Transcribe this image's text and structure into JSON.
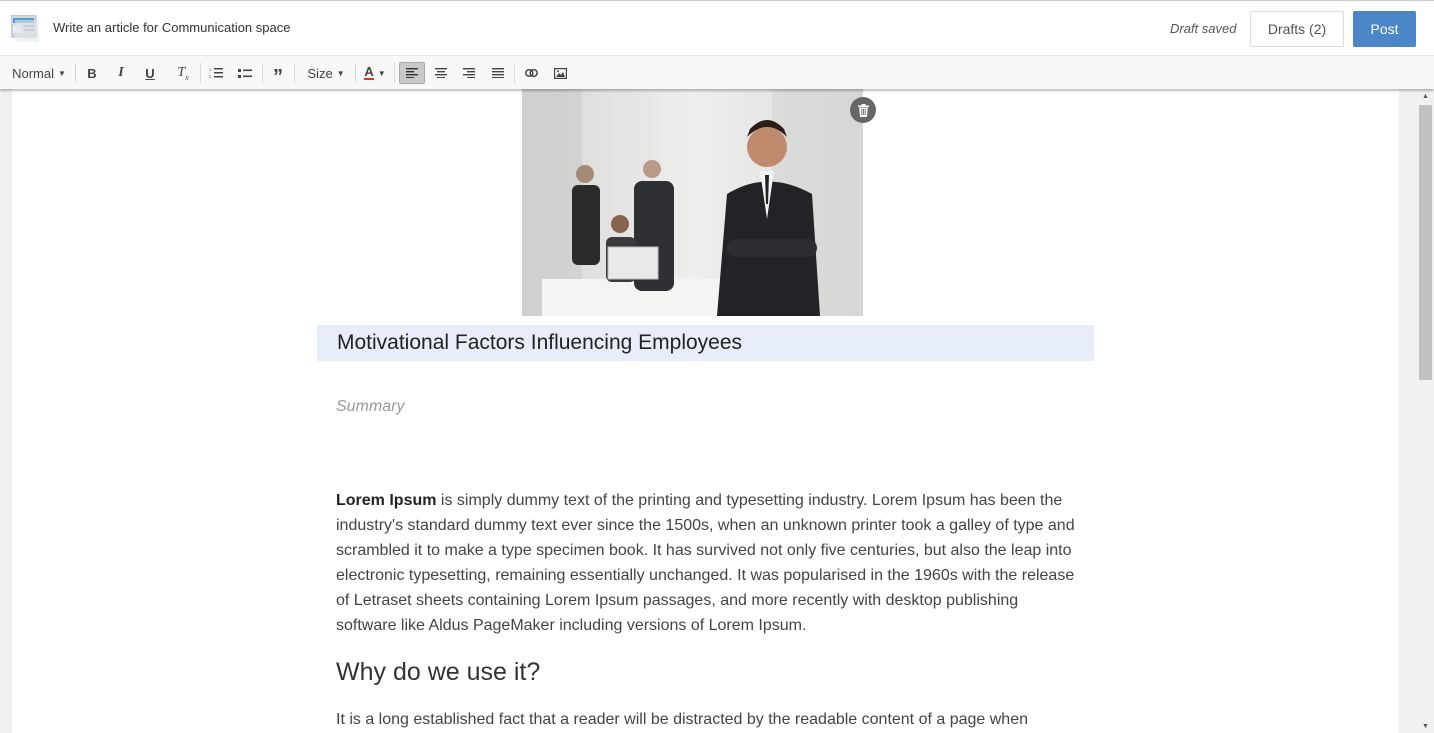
{
  "header": {
    "title": "Write an article for Communication space",
    "status": "Draft saved",
    "drafts_label": "Drafts (2)",
    "post_label": "Post"
  },
  "toolbar": {
    "format_label": "Normal",
    "size_label": "Size",
    "buttons": [
      "bold-icon",
      "italic-icon",
      "underline-icon",
      "remove-format-icon",
      "numbered-list-icon",
      "bulleted-list-icon",
      "blockquote-icon",
      "text-color-icon",
      "align-left-icon",
      "align-center-icon",
      "align-right-icon",
      "align-justify-icon",
      "link-icon",
      "image-icon"
    ],
    "active_alignment": "left"
  },
  "article": {
    "title": "Motivational Factors Influencing Employees",
    "summary_placeholder": "Summary",
    "lead_bold": "Lorem Ipsum",
    "lead_text": " is simply dummy text of the printing and typesetting industry. Lorem Ipsum has been the industry's standard dummy text ever since the 1500s, when an unknown printer took a galley of type and scrambled it to make a type specimen book. It has survived not only five centuries, but also the leap into electronic typesetting, remaining essentially unchanged. It was popularised in the 1960s with the release of Letraset sheets containing Lorem Ipsum passages, and more recently with desktop publishing software like Aldus PageMaker including versions of Lorem Ipsum.",
    "heading2": "Why do we use it?",
    "para2": "It is a long established fact that a reader will be distracted by the readable content of a page when"
  },
  "colors": {
    "accent": "#4a86c8",
    "title_bg": "#e8eef9"
  }
}
